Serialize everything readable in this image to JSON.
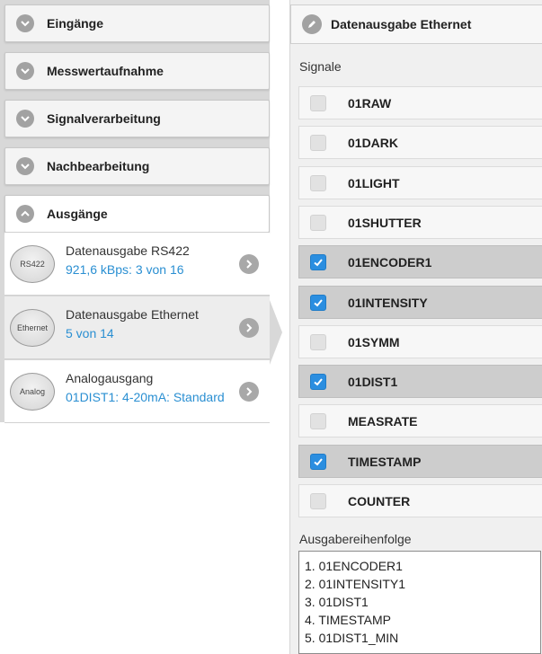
{
  "left_panel": {
    "sections": [
      {
        "label": "Eingänge",
        "expanded": false
      },
      {
        "label": "Messwertaufnahme",
        "expanded": false
      },
      {
        "label": "Signalverarbeitung",
        "expanded": false
      },
      {
        "label": "Nachbearbeitung",
        "expanded": false
      },
      {
        "label": "Ausgänge",
        "expanded": true
      }
    ],
    "outputs": [
      {
        "icon_text": "RS422",
        "title": "Datenausgabe RS422",
        "value": "921,6 kBps: 3 von 16",
        "selected": false
      },
      {
        "icon_text": "Ethernet",
        "title": "Datenausgabe Ethernet",
        "value": "5 von 14",
        "selected": true
      },
      {
        "icon_text": "Analog",
        "title": "Analogausgang",
        "value": "01DIST1: 4-20mA: Standard",
        "selected": false
      }
    ]
  },
  "right_panel": {
    "title": "Datenausgabe Ethernet",
    "signals_label": "Signale",
    "signals": [
      {
        "label": "01RAW",
        "checked": false
      },
      {
        "label": "01DARK",
        "checked": false
      },
      {
        "label": "01LIGHT",
        "checked": false
      },
      {
        "label": "01SHUTTER",
        "checked": false
      },
      {
        "label": "01ENCODER1",
        "checked": true
      },
      {
        "label": "01INTENSITY",
        "checked": true
      },
      {
        "label": "01SYMM",
        "checked": false
      },
      {
        "label": "01DIST1",
        "checked": true
      },
      {
        "label": "MEASRATE",
        "checked": false
      },
      {
        "label": "TIMESTAMP",
        "checked": true
      },
      {
        "label": "COUNTER",
        "checked": false
      }
    ],
    "order_label": "Ausgabereihenfolge",
    "order_items": [
      "1. 01ENCODER1",
      "2. 01INTENSITY1",
      "3. 01DIST1",
      "4. TIMESTAMP",
      "5. 01DIST1_MIN"
    ]
  },
  "colors": {
    "accent": "#2b8ee0",
    "link_value": "#2a8fd2",
    "icon_gray": "#a2a2a2"
  }
}
